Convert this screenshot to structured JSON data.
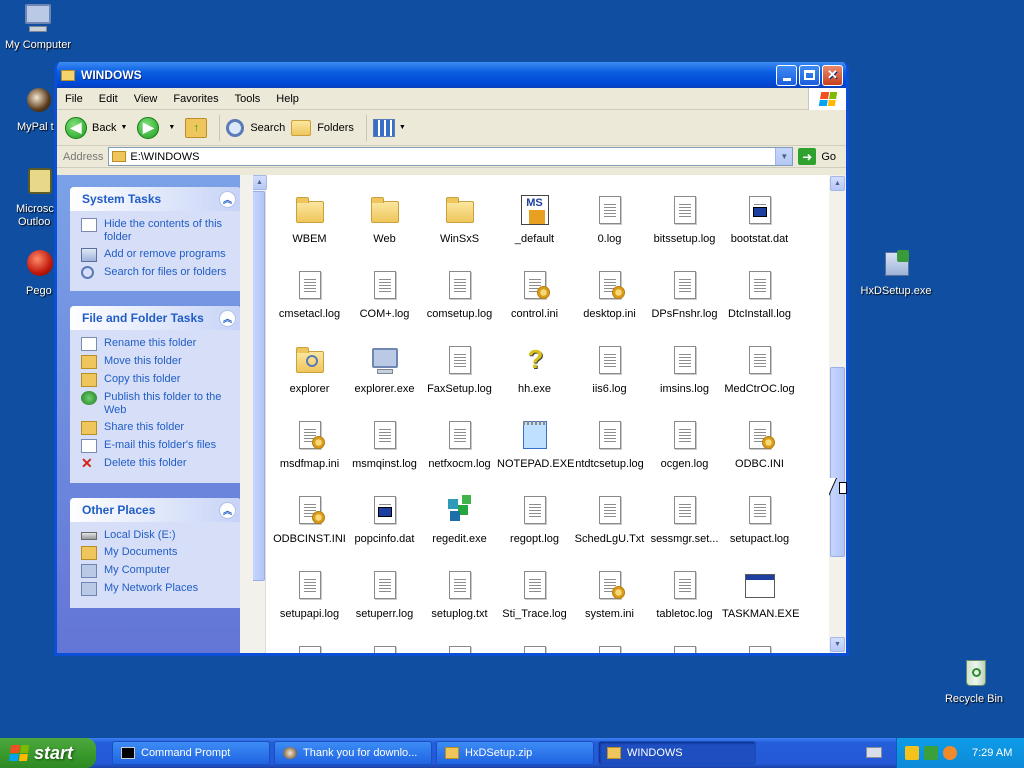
{
  "desktop": {
    "icons": [
      {
        "label": "My Computer"
      },
      {
        "label": "MyPal t"
      },
      {
        "label": "Microsc"
      },
      {
        "label": "Outloo"
      },
      {
        "label": "Pego"
      },
      {
        "label": "HxDSetup.exe"
      },
      {
        "label": "Recycle Bin"
      }
    ]
  },
  "window": {
    "title": "WINDOWS",
    "menu": [
      "File",
      "Edit",
      "View",
      "Favorites",
      "Tools",
      "Help"
    ],
    "toolbar": {
      "back": "Back",
      "search": "Search",
      "folders": "Folders"
    },
    "address": {
      "label": "Address",
      "value": "E:\\WINDOWS",
      "go": "Go"
    }
  },
  "tasks": {
    "system": {
      "title": "System Tasks",
      "items": [
        "Hide the contents of this folder",
        "Add or remove programs",
        "Search for files or folders"
      ]
    },
    "file_folder": {
      "title": "File and Folder Tasks",
      "items": [
        "Rename this folder",
        "Move this folder",
        "Copy this folder",
        "Publish this folder to the Web",
        "Share this folder",
        "E-mail this folder's files",
        "Delete this folder"
      ]
    },
    "other": {
      "title": "Other Places",
      "items": [
        "Local Disk (E:)",
        "My Documents",
        "My Computer",
        "My Network Places"
      ]
    }
  },
  "files": [
    {
      "name": "WBEM",
      "icon": "folder-icon"
    },
    {
      "name": "Web",
      "icon": "folder-icon"
    },
    {
      "name": "WinSxS",
      "icon": "folder-icon"
    },
    {
      "name": "_default",
      "icon": "ms-shortcut-icon"
    },
    {
      "name": "0.log",
      "icon": "text-file-icon"
    },
    {
      "name": "bitssetup.log",
      "icon": "text-file-icon"
    },
    {
      "name": "bootstat.dat",
      "icon": "data-file-icon"
    },
    {
      "name": "cmsetacl.log",
      "icon": "text-file-icon"
    },
    {
      "name": "COM+.log",
      "icon": "text-file-icon"
    },
    {
      "name": "comsetup.log",
      "icon": "text-file-icon"
    },
    {
      "name": "control.ini",
      "icon": "config-file-icon"
    },
    {
      "name": "desktop.ini",
      "icon": "config-file-icon"
    },
    {
      "name": "DPsFnshr.log",
      "icon": "text-file-icon"
    },
    {
      "name": "DtcInstall.log",
      "icon": "text-file-icon"
    },
    {
      "name": "explorer",
      "icon": "explorer-folder-icon"
    },
    {
      "name": "explorer.exe",
      "icon": "computer-app-icon"
    },
    {
      "name": "FaxSetup.log",
      "icon": "text-file-icon"
    },
    {
      "name": "hh.exe",
      "icon": "help-icon"
    },
    {
      "name": "iis6.log",
      "icon": "text-file-icon"
    },
    {
      "name": "imsins.log",
      "icon": "text-file-icon"
    },
    {
      "name": "MedCtrOC.log",
      "icon": "text-file-icon"
    },
    {
      "name": "msdfmap.ini",
      "icon": "config-file-icon"
    },
    {
      "name": "msmqinst.log",
      "icon": "text-file-icon"
    },
    {
      "name": "netfxocm.log",
      "icon": "text-file-icon"
    },
    {
      "name": "NOTEPAD.EXE",
      "icon": "notepad-icon"
    },
    {
      "name": "ntdtcsetup.log",
      "icon": "text-file-icon"
    },
    {
      "name": "ocgen.log",
      "icon": "text-file-icon"
    },
    {
      "name": "ODBC.INI",
      "icon": "config-file-icon"
    },
    {
      "name": "ODBCINST.INI",
      "icon": "config-file-icon"
    },
    {
      "name": "popcinfo.dat",
      "icon": "data-file-icon"
    },
    {
      "name": "regedit.exe",
      "icon": "regedit-icon"
    },
    {
      "name": "regopt.log",
      "icon": "text-file-icon"
    },
    {
      "name": "SchedLgU.Txt",
      "icon": "text-file-icon"
    },
    {
      "name": "sessmgr.set...",
      "icon": "text-file-icon"
    },
    {
      "name": "setupact.log",
      "icon": "text-file-icon"
    },
    {
      "name": "setupapi.log",
      "icon": "text-file-icon"
    },
    {
      "name": "setuperr.log",
      "icon": "text-file-icon"
    },
    {
      "name": "setuplog.txt",
      "icon": "text-file-icon"
    },
    {
      "name": "Sti_Trace.log",
      "icon": "text-file-icon"
    },
    {
      "name": "system.ini",
      "icon": "config-file-icon"
    },
    {
      "name": "tabletoc.log",
      "icon": "text-file-icon"
    },
    {
      "name": "TASKMAN.EXE",
      "icon": "app-window-icon"
    }
  ],
  "taskbar": {
    "start": "start",
    "tasks": [
      {
        "label": "Command Prompt",
        "icon": "cmd-icon"
      },
      {
        "label": "Thank you for downlo...",
        "icon": "browser-icon"
      },
      {
        "label": "HxDSetup.zip",
        "icon": "zip-folder-icon"
      },
      {
        "label": "WINDOWS",
        "icon": "folder-icon"
      }
    ],
    "clock": "7:29 AM"
  },
  "colors": {
    "desktop": "#0f4ea1",
    "titlebar": "#0a5ee0",
    "task_link": "#215dc6"
  }
}
